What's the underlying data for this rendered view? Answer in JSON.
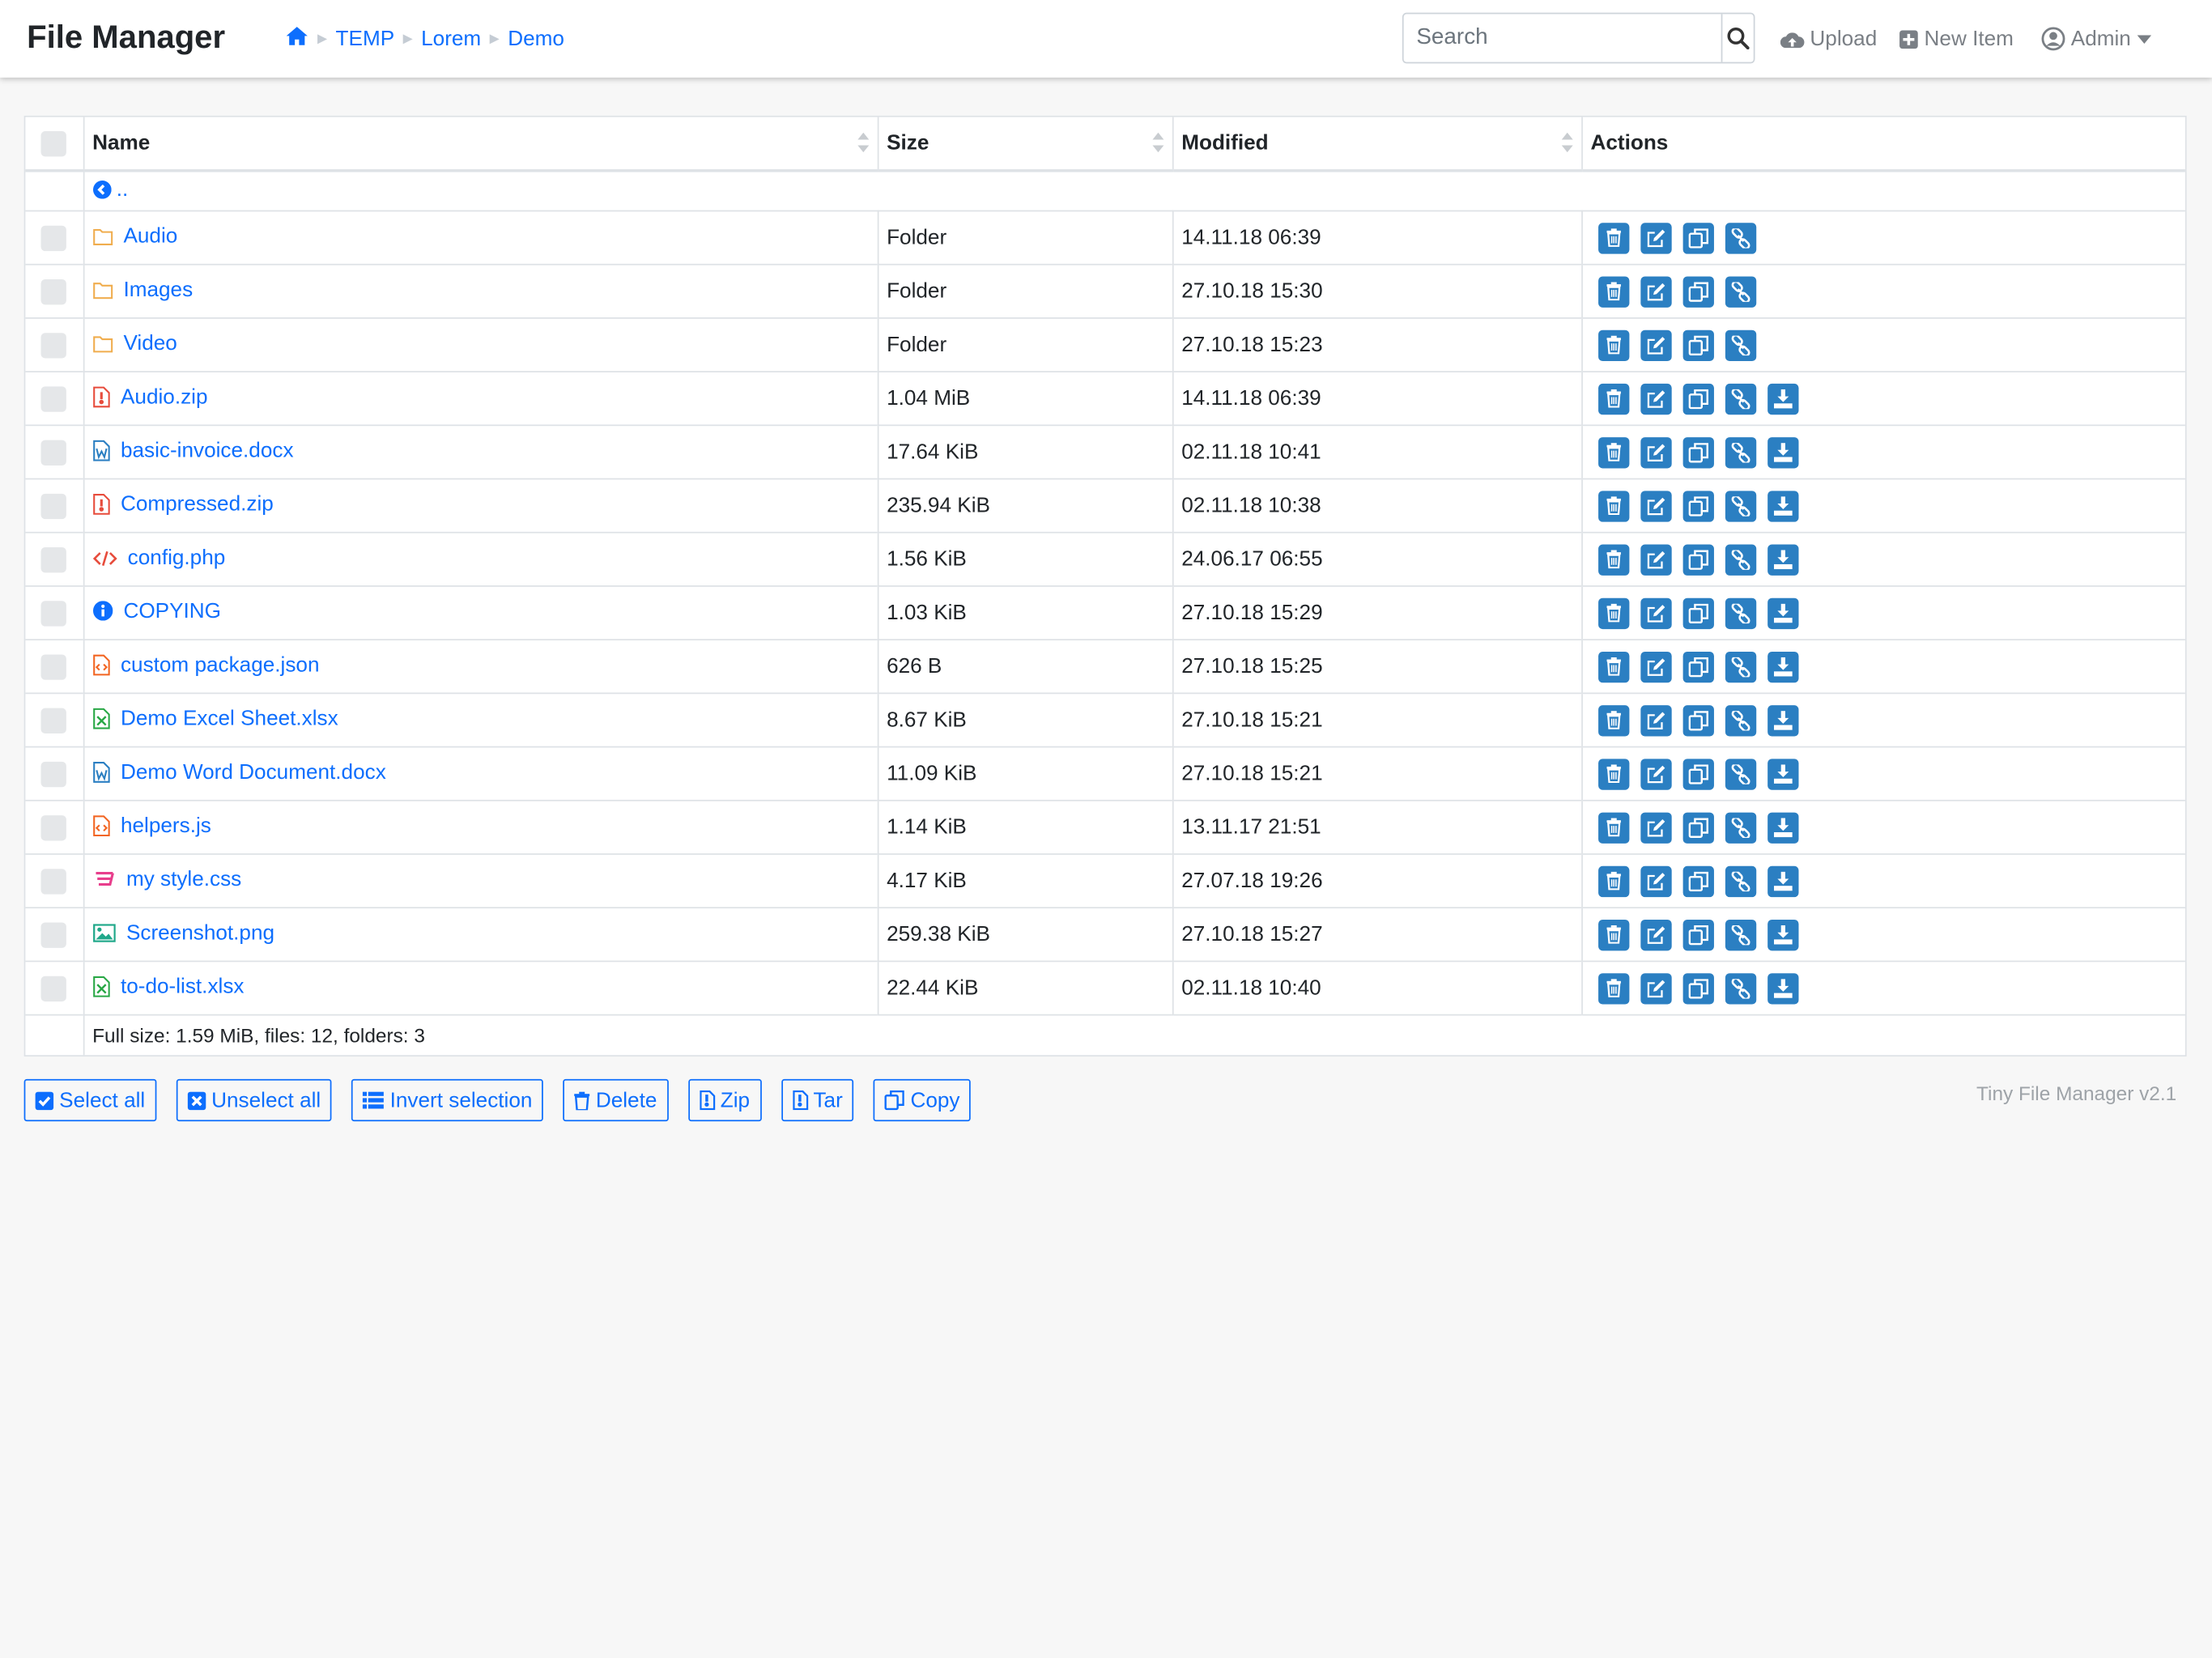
{
  "navbar": {
    "brand": "File Manager",
    "breadcrumb": [
      "TEMP",
      "Lorem",
      "Demo"
    ],
    "search_placeholder": "Search",
    "upload_label": "Upload",
    "new_item_label": "New Item",
    "user_label": "Admin"
  },
  "table": {
    "headers": {
      "name": "Name",
      "size": "Size",
      "modified": "Modified",
      "actions": "Actions"
    },
    "parent_link": "..",
    "rows": [
      {
        "name": "Audio",
        "size": "Folder",
        "modified": "14.11.18 06:39",
        "icon": "folder-icon",
        "color": "#f0ad4e",
        "download": false
      },
      {
        "name": "Images",
        "size": "Folder",
        "modified": "27.10.18 15:30",
        "icon": "folder-icon",
        "color": "#f0ad4e",
        "download": false
      },
      {
        "name": "Video",
        "size": "Folder",
        "modified": "27.10.18 15:23",
        "icon": "folder-icon",
        "color": "#f0ad4e",
        "download": false
      },
      {
        "name": "Audio.zip",
        "size": "1.04 MiB",
        "modified": "14.11.18 06:39",
        "icon": "file-zip-icon",
        "color": "#e74c3c",
        "download": true
      },
      {
        "name": "basic-invoice.docx",
        "size": "17.64 KiB",
        "modified": "02.11.18 10:41",
        "icon": "file-word-icon",
        "color": "#2b7fc2",
        "download": true
      },
      {
        "name": "Compressed.zip",
        "size": "235.94 KiB",
        "modified": "02.11.18 10:38",
        "icon": "file-zip-icon",
        "color": "#e74c3c",
        "download": true
      },
      {
        "name": "config.php",
        "size": "1.56 KiB",
        "modified": "24.06.17 06:55",
        "icon": "code-icon",
        "color": "#e74c3c",
        "download": true
      },
      {
        "name": "COPYING",
        "size": "1.03 KiB",
        "modified": "27.10.18 15:29",
        "icon": "info-circle-icon",
        "color": "#0d6efd",
        "download": true
      },
      {
        "name": "custom package.json",
        "size": "626 B",
        "modified": "27.10.18 15:25",
        "icon": "file-code-icon",
        "color": "#f26522",
        "download": true
      },
      {
        "name": "Demo Excel Sheet.xlsx",
        "size": "8.67 KiB",
        "modified": "27.10.18 15:21",
        "icon": "file-excel-icon",
        "color": "#28a745",
        "download": true
      },
      {
        "name": "Demo Word Document.docx",
        "size": "11.09 KiB",
        "modified": "27.10.18 15:21",
        "icon": "file-word-icon",
        "color": "#2b7fc2",
        "download": true
      },
      {
        "name": "helpers.js",
        "size": "1.14 KiB",
        "modified": "13.11.17 21:51",
        "icon": "file-code-icon",
        "color": "#f26522",
        "download": true
      },
      {
        "name": "my style.css",
        "size": "4.17 KiB",
        "modified": "27.07.18 19:26",
        "icon": "css3-icon",
        "color": "#e83e8c",
        "download": true
      },
      {
        "name": "Screenshot.png",
        "size": "259.38 KiB",
        "modified": "27.10.18 15:27",
        "icon": "image-icon",
        "color": "#20a88a",
        "download": true
      },
      {
        "name": "to-do-list.xlsx",
        "size": "22.44 KiB",
        "modified": "02.11.18 10:40",
        "icon": "file-excel-icon",
        "color": "#28a745",
        "download": true
      }
    ],
    "footer": "Full size: 1.59 MiB, files: 12, folders: 3"
  },
  "bottom_buttons": {
    "select_all": "Select all",
    "unselect_all": "Unselect all",
    "invert_selection": "Invert selection",
    "delete": "Delete",
    "zip": "Zip",
    "tar": "Tar",
    "copy": "Copy"
  },
  "version": "Tiny File Manager v2.1",
  "colors": {
    "accent": "#0d6efd",
    "action_button": "#2b7fc2",
    "background": "#f7f7f7"
  }
}
